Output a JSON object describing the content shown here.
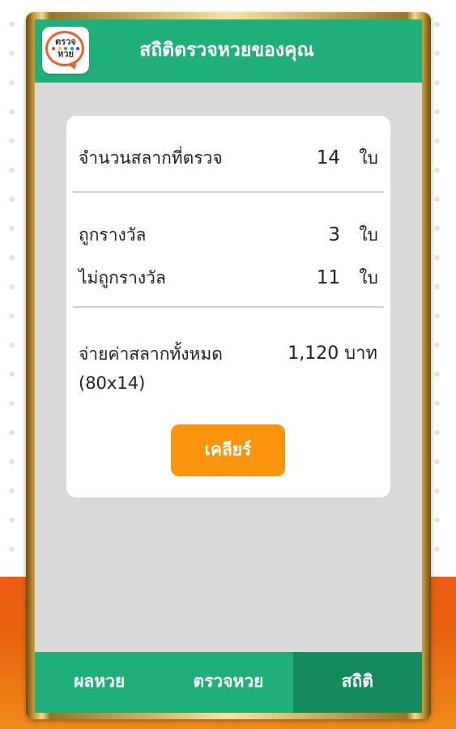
{
  "header": {
    "title": "สถิติตรวจหวยของคุณ",
    "logo_line1": "ตรวจ",
    "logo_line2": "หวย"
  },
  "stats": {
    "checked": {
      "label": "จำนวนสลากที่ตรวจ",
      "value": "14",
      "unit": "ใบ"
    },
    "won": {
      "label": "ถูกรางวัล",
      "value": "3",
      "unit": "ใบ"
    },
    "lost": {
      "label": "ไม่ถูกรางวัล",
      "value": "11",
      "unit": "ใบ"
    },
    "total": {
      "label_line1": "จ่ายค่าสลากทั้งหมด",
      "label_line2": "(80x14)",
      "value": "1,120 บาท"
    }
  },
  "clear_button": {
    "label": "เคลียร์"
  },
  "tabs": [
    {
      "label": "ผลหวย"
    },
    {
      "label": "ตรวจหวย"
    },
    {
      "label": "สถิติ"
    }
  ],
  "active_tab": "สถิติ",
  "colors": {
    "primary_green": "#1fb07a",
    "active_tab_green": "#158b5d",
    "button_orange": "#fb940d",
    "screen_bg": "#d9d9d9"
  }
}
